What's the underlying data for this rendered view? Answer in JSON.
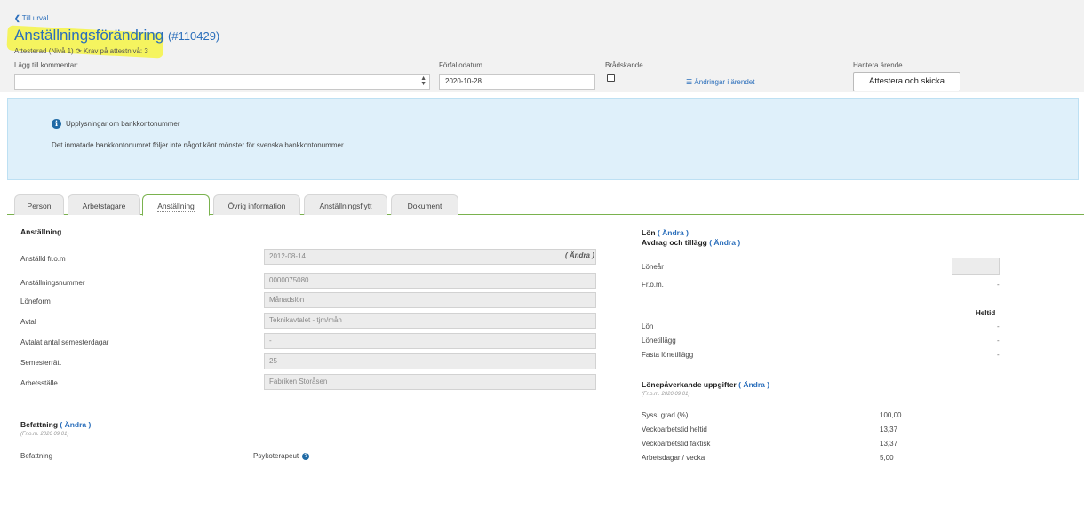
{
  "header": {
    "back_label": "Till urval",
    "title": "Anställningsförändring",
    "case_number": "(#110429)",
    "status": "Attesterad (Nivå 1)",
    "requirement": "Krav på attestnivå: 3"
  },
  "form": {
    "comment_label": "Lägg till kommentar:",
    "comment_value": "",
    "due_label": "Förfallodatum",
    "due_value": "2020-10-28",
    "urgent_label": "Brådskande",
    "changes_link": "Ändringar i ärendet",
    "manage_label": "Hantera ärende",
    "submit_button": "Attestera och skicka"
  },
  "info": {
    "title": "Upplysningar om bankkontonummer",
    "message": "Det inmatade bankkontonumret följer inte något känt mönster för svenska bankkontonummer."
  },
  "tabs": [
    {
      "label": "Person"
    },
    {
      "label": "Arbetstagare"
    },
    {
      "label": "Anställning"
    },
    {
      "label": "Övrig information"
    },
    {
      "label": "Anställningsflytt"
    },
    {
      "label": "Dokument"
    }
  ],
  "employment": {
    "title": "Anställning",
    "change_link": "( Ändra )",
    "fields": [
      {
        "label": "Anställd fr.o.m",
        "value": "2012-08-14"
      },
      {
        "label": "Anställningsnummer",
        "value": "0000075080"
      },
      {
        "label": "Löneform",
        "value": "Månadslön"
      },
      {
        "label": "Avtal",
        "value": "Teknikavtalet - tjm/mån"
      },
      {
        "label": "Avtalat antal semesterdagar",
        "value": "-"
      },
      {
        "label": "Semesterrätt",
        "value": "25"
      },
      {
        "label": "Arbetsställe",
        "value": "Fabriken Storåsen"
      }
    ]
  },
  "position": {
    "title": "Befattning",
    "change_link": "( Ändra )",
    "from_date": "(Fr.o.m. 2020 09 01)",
    "label": "Befattning",
    "value": "Psykoterapeut"
  },
  "salary": {
    "title": "Lön",
    "change_link": "( Ändra )",
    "deductions_title": "Avdrag och tillägg",
    "deductions_link": "( Ändra )",
    "year_label": "Löneår",
    "year_value": "",
    "from_label": "Fr.o.m.",
    "from_value": "-",
    "column_header": "Heltid",
    "rows": [
      {
        "label": "Lön",
        "value": "-"
      },
      {
        "label": "Lönetillägg",
        "value": "-"
      },
      {
        "label": "Fasta lönetillägg",
        "value": "-"
      }
    ]
  },
  "salary_factors": {
    "title": "Lönepåverkande uppgifter",
    "change_link": "( Ändra )",
    "from_date": "(Fr.o.m. 2020 09 01)",
    "rows": [
      {
        "label": "Syss. grad (%)",
        "value": "100,00"
      },
      {
        "label": "Veckoarbetstid heltid",
        "value": "13,37"
      },
      {
        "label": "Veckoarbetstid faktisk",
        "value": "13,37"
      },
      {
        "label": "Arbetsdagar / vecka",
        "value": "5,00"
      }
    ]
  },
  "colors": {
    "accent": "#2a6ebb",
    "tab_active": "#7ab24e",
    "info_bg": "#dff0fa",
    "highlight": "#f6f545"
  }
}
